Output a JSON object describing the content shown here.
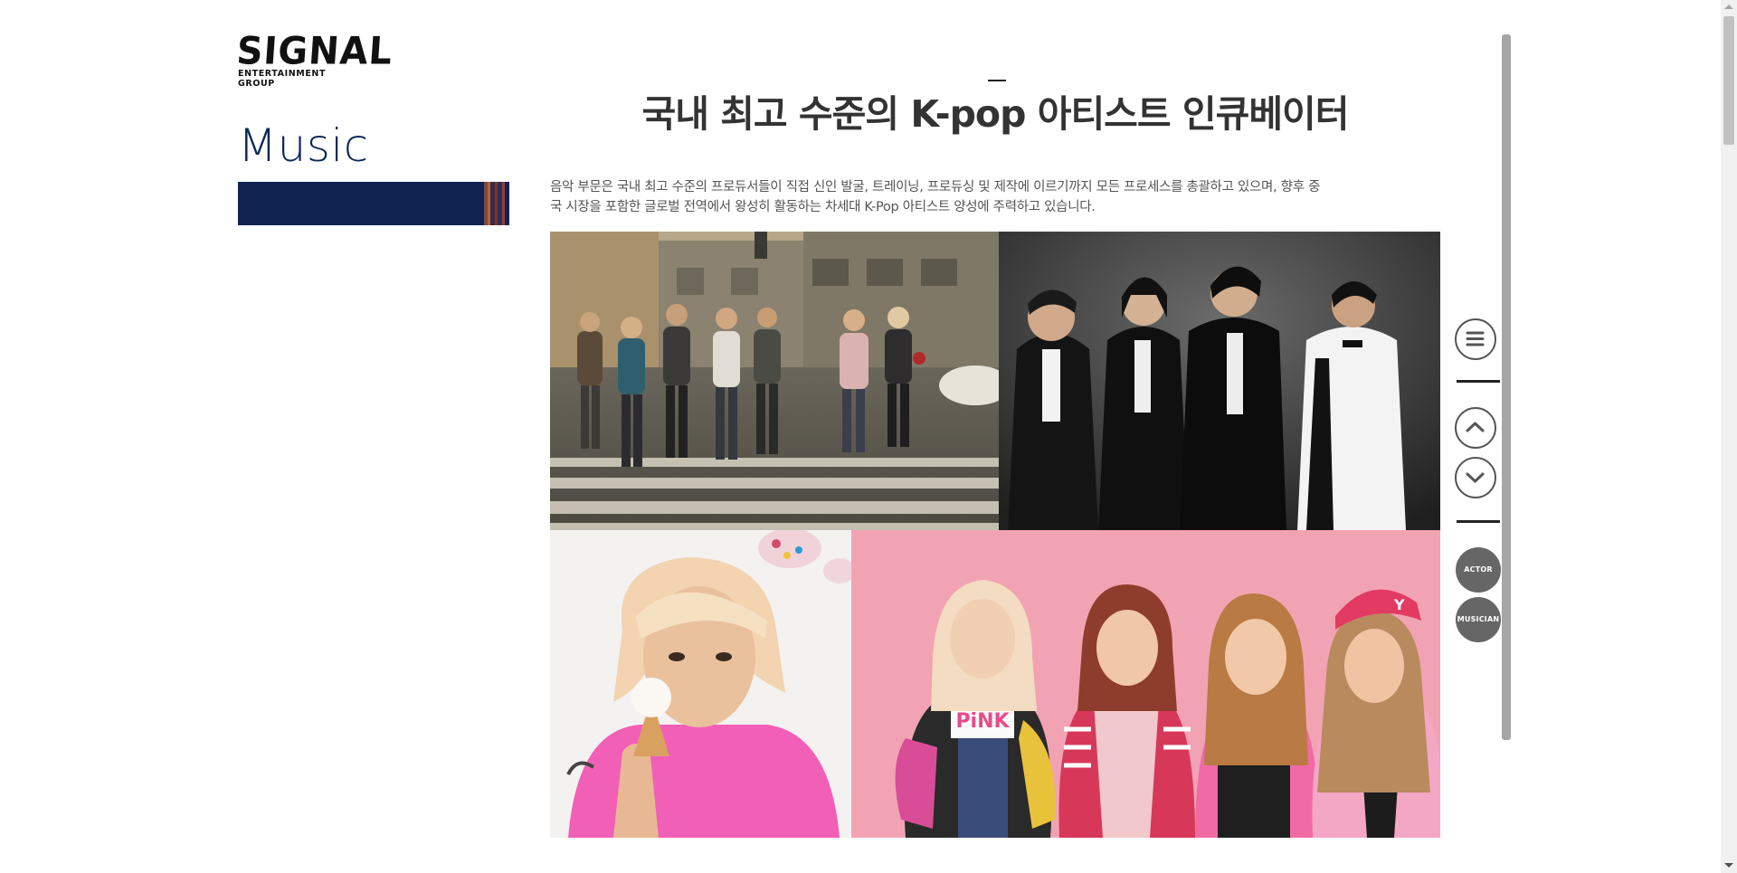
{
  "brand": {
    "name": "SIGNAL",
    "subtitle": "ENTERTAINMENT GROUP"
  },
  "section": {
    "title": "Music"
  },
  "main": {
    "headline": "국내 최고 수준의 K-pop 아티스트 인큐베이터",
    "description_line1": "음악 부문은 국내 최고 수준의 프로듀서들이 직접 신인 발굴, 트레이닝, 프로듀싱 및 제작에 이르기까지 모든 프로세스를 총괄하고 있으며, 향후 중",
    "description_line2": "국 시장을 포함한 글로벌 전역에서 왕성히 활동하는 차세대 K-Pop 아티스트 양성에 주력하고 있습니다."
  },
  "photos": [
    {
      "name": "boy-group-crosswalk-photo"
    },
    {
      "name": "boy-group-suits-photo"
    },
    {
      "name": "solo-artist-icecream-photo"
    },
    {
      "name": "girl-group-pink-photo",
      "shirt_text": "PiNK",
      "hat_text": "Y"
    }
  ],
  "float_nav": {
    "menu_icon": "hamburger-icon",
    "up_icon": "chevron-up-icon",
    "down_icon": "chevron-down-icon",
    "actor_label": "ACTOR",
    "musician_label": "MUSICIAN"
  },
  "colors": {
    "navy": "#0e244e",
    "title_blue": "#0d2a57",
    "dark_button": "#666666"
  }
}
